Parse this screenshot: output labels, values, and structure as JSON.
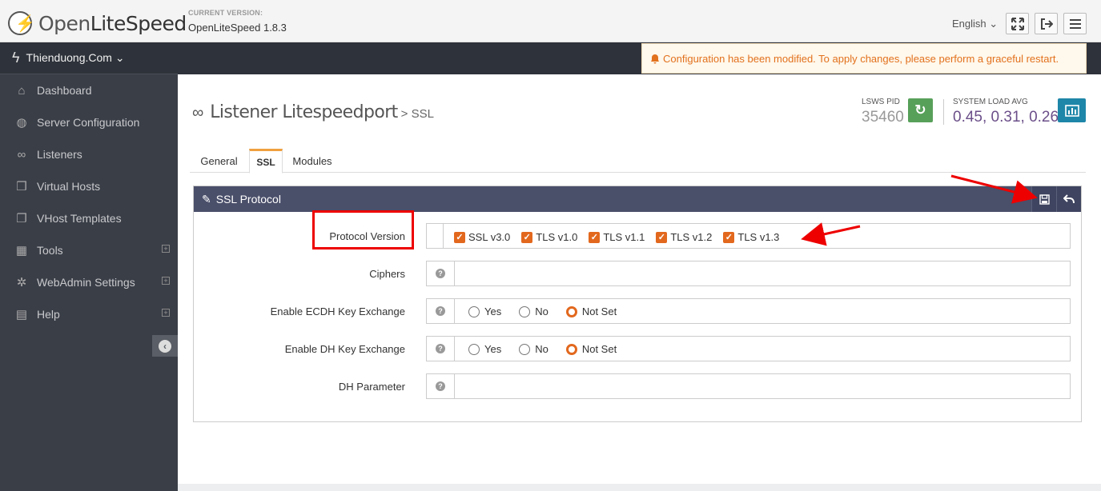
{
  "app": {
    "logo_text_light": "Open",
    "logo_text_bold": "LiteSpeed",
    "version_label": "CURRENT VERSION:",
    "version_value": "OpenLiteSpeed 1.8.3",
    "language": "English ⌄"
  },
  "header_buttons": [
    {
      "name": "fullscreen",
      "icon": "expand-icon"
    },
    {
      "name": "logout",
      "icon": "sign-out-icon"
    },
    {
      "name": "menu",
      "icon": "menu-icon"
    }
  ],
  "sidebar": {
    "site_name": "Thienduong.Com ⌄",
    "items": [
      {
        "label": "Dashboard",
        "icon": "home-icon"
      },
      {
        "label": "Server Configuration",
        "icon": "globe-icon"
      },
      {
        "label": "Listeners",
        "icon": "link-icon"
      },
      {
        "label": "Virtual Hosts",
        "icon": "cubes-icon"
      },
      {
        "label": "VHost Templates",
        "icon": "copy-icon"
      },
      {
        "label": "Tools",
        "icon": "grid-icon"
      },
      {
        "label": "WebAdmin Settings",
        "icon": "gear-icon"
      },
      {
        "label": "Help",
        "icon": "book-icon"
      }
    ]
  },
  "notice": {
    "text": "Configuration has been modified. To apply changes, please perform a graceful restart.",
    "color": "#e2711d"
  },
  "page": {
    "title": "Listener Litespeedport",
    "subtitle": "> SSL"
  },
  "stats": {
    "pid_label": "LSWS PID",
    "pid_value": "35460",
    "load_label": "SYSTEM LOAD AVG",
    "load_value": "0.45, 0.31, 0.26"
  },
  "tabs": [
    {
      "label": "General",
      "active": false
    },
    {
      "label": "SSL",
      "active": true
    },
    {
      "label": "Modules",
      "active": false
    }
  ],
  "panel": {
    "title": "SSL Protocol",
    "rows": {
      "protocol": {
        "label": "Protocol Version",
        "options": [
          {
            "label": "SSL v3.0",
            "checked": true
          },
          {
            "label": "TLS v1.0",
            "checked": true
          },
          {
            "label": "TLS v1.1",
            "checked": true
          },
          {
            "label": "TLS v1.2",
            "checked": true
          },
          {
            "label": "TLS v1.3",
            "checked": true
          }
        ]
      },
      "ciphers": {
        "label": "Ciphers",
        "value": ""
      },
      "ecdh": {
        "label": "Enable ECDH Key Exchange",
        "yes": "Yes",
        "no": "No",
        "notset": "Not Set",
        "selected": "Not Set"
      },
      "dh": {
        "label": "Enable DH Key Exchange",
        "yes": "Yes",
        "no": "No",
        "notset": "Not Set",
        "selected": "Not Set"
      },
      "dhparam": {
        "label": "DH Parameter",
        "value": ""
      }
    }
  },
  "colors": {
    "accent": "#e2681e",
    "panel_header": "#4a4f6a",
    "sidebar": "#3a3e47",
    "annotation": "#ee0000"
  }
}
